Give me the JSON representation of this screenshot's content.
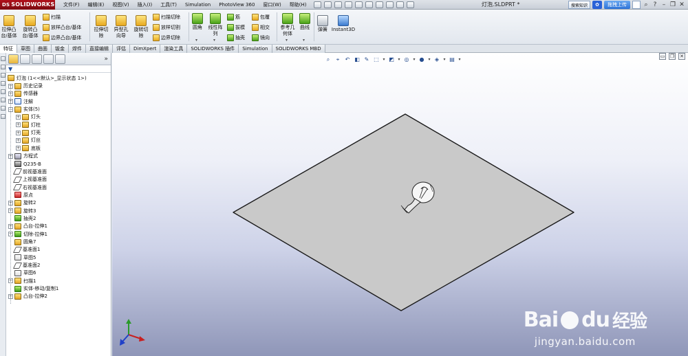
{
  "app": {
    "logo": "SOLIDWORKS",
    "logo_prefix": "DS",
    "doc_title": "灯泡.SLDPRT *"
  },
  "menu": [
    "文件(F)",
    "编辑(E)",
    "视图(V)",
    "插入(I)",
    "工具(T)",
    "Simulation",
    "PhotoView 360",
    "窗口(W)",
    "帮助(H)"
  ],
  "titlebar_right": {
    "search": "搜索知识",
    "upload": "拖拽上传"
  },
  "toolbar": {
    "extrude_boss": "拉伸凸\n台/基体",
    "revolve_boss": "旋转凸\n台/基体",
    "sweep": "扫描",
    "loft": "放样凸台/基体",
    "boundary_boss": "边界凸台/基体",
    "extrude_cut": "拉伸切\n除",
    "hole_wizard": "异型孔\n向导",
    "revolve_cut": "旋转切\n除",
    "swept_cut": "扫描切除",
    "lofted_cut": "放样切割",
    "boundary_cut": "边界切除",
    "fillet": "圆角",
    "linear_pattern": "线性阵\n列",
    "rib": "筋",
    "draft": "拔模",
    "shell": "抽壳",
    "wrap": "包覆",
    "intersect": "相交",
    "mirror": "镜向",
    "ref_geometry": "参考几\n何体",
    "curves": "曲线",
    "spring": "弹簧",
    "instant3d": "Instant3D"
  },
  "tabs": [
    "特征",
    "草图",
    "曲面",
    "钣金",
    "焊件",
    "直接编辑",
    "评估",
    "DimXpert",
    "渲染工具",
    "SOLIDWORKS 插件",
    "Simulation",
    "SOLIDWORKS MBD"
  ],
  "tree": {
    "root": "灯泡  (1<<默认>_显示状态 1>)",
    "items": [
      {
        "label": "历史记录",
        "icon": "history-icon"
      },
      {
        "label": "传感器",
        "icon": "sensor-icon"
      },
      {
        "label": "注解",
        "icon": "annotation-icon"
      },
      {
        "label": "实体(5)",
        "icon": "solid-bodies-icon"
      },
      {
        "label": "灯头",
        "icon": "body-icon"
      },
      {
        "label": "灯柱",
        "icon": "body-icon"
      },
      {
        "label": "灯壳",
        "icon": "body-icon"
      },
      {
        "label": "灯丝",
        "icon": "body-icon"
      },
      {
        "label": "底板",
        "icon": "body-icon"
      },
      {
        "label": "方程式",
        "icon": "equations-icon"
      },
      {
        "label": "Q235-B",
        "icon": "material-icon"
      },
      {
        "label": "前视基准面",
        "icon": "plane-icon"
      },
      {
        "label": "上视基准面",
        "icon": "plane-icon"
      },
      {
        "label": "右视基准面",
        "icon": "plane-icon"
      },
      {
        "label": "原点",
        "icon": "origin-icon"
      },
      {
        "label": "旋转2",
        "icon": "revolve-icon"
      },
      {
        "label": "旋转3",
        "icon": "revolve-icon"
      },
      {
        "label": "抽壳2",
        "icon": "shell-icon"
      },
      {
        "label": "凸台-拉伸1",
        "icon": "extrude-icon"
      },
      {
        "label": "切除-拉伸1",
        "icon": "cut-extrude-icon"
      },
      {
        "label": "圆角7",
        "icon": "fillet-icon"
      },
      {
        "label": "基准面1",
        "icon": "plane-icon"
      },
      {
        "label": "草图5",
        "icon": "sketch-icon"
      },
      {
        "label": "基准面2",
        "icon": "plane-icon"
      },
      {
        "label": "草图6",
        "icon": "sketch-icon"
      },
      {
        "label": "扫描1",
        "icon": "sweep-icon"
      },
      {
        "label": "实体-移动/复制1",
        "icon": "move-copy-icon"
      },
      {
        "label": "凸台-拉伸2",
        "icon": "extrude-icon"
      }
    ]
  },
  "watermark": {
    "brand_latin": "Bai",
    "brand_du": "du",
    "brand_cn": "经验",
    "url": "jingyan.baidu.com"
  },
  "colors": {
    "plate_fill": "#c9c9c9",
    "plate_edge": "#1a1a1a",
    "accent_tab": "#ffffff"
  }
}
